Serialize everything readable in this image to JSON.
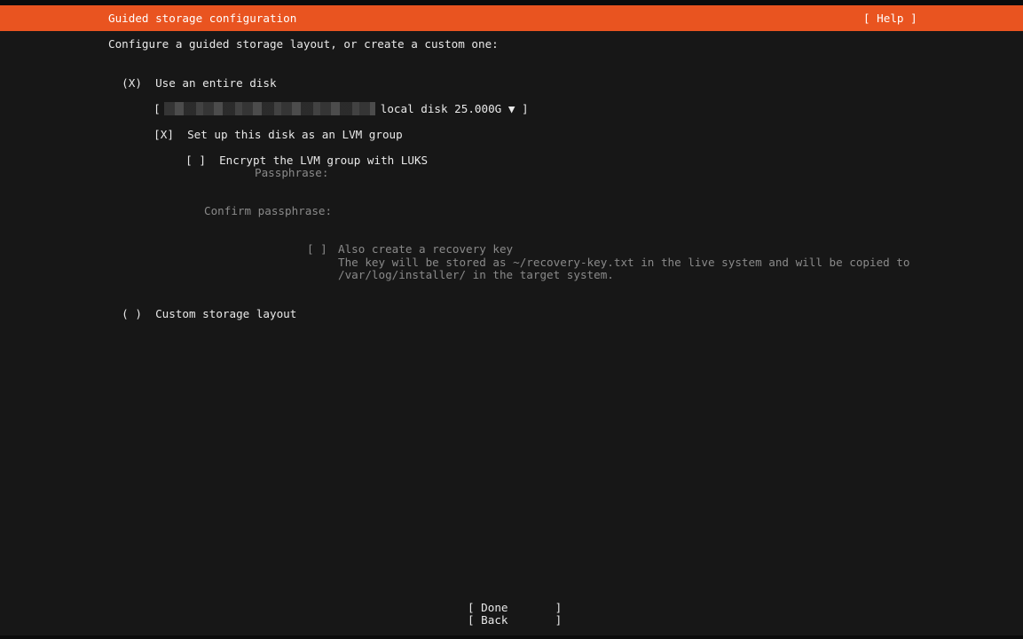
{
  "header": {
    "title": "Guided storage configuration",
    "help_label": "[ Help ]"
  },
  "intro": "Configure a guided storage layout, or create a custom one:",
  "options": {
    "entire_disk": {
      "radio": "(X)",
      "label": "Use an entire disk"
    },
    "disk_select": {
      "open_bracket": "[",
      "value": "local disk 25.000G",
      "arrow": "▼",
      "close_bracket": "]"
    },
    "lvm": {
      "checkbox": "[X]",
      "label": "Set up this disk as an LVM group"
    },
    "luks": {
      "checkbox": "[ ]",
      "label": "Encrypt the LVM group with LUKS"
    },
    "passphrase": {
      "label": "Passphrase:"
    },
    "confirm_passphrase": {
      "label": "Confirm passphrase:"
    },
    "recovery": {
      "checkbox": "[ ]",
      "label": "Also create a recovery key",
      "desc_line1": "The key will be stored as ~/recovery-key.txt in the live system and will be copied to",
      "desc_line2": "/var/log/installer/ in the target system."
    },
    "custom": {
      "radio": "( )",
      "label": "Custom storage layout"
    }
  },
  "buttons": {
    "done": "[ Done       ]",
    "back": "[ Back       ]"
  },
  "colors": {
    "accent": "#e95420",
    "background": "#171717",
    "text": "#e9e9e9",
    "disabled_text": "#8a8a8a"
  }
}
